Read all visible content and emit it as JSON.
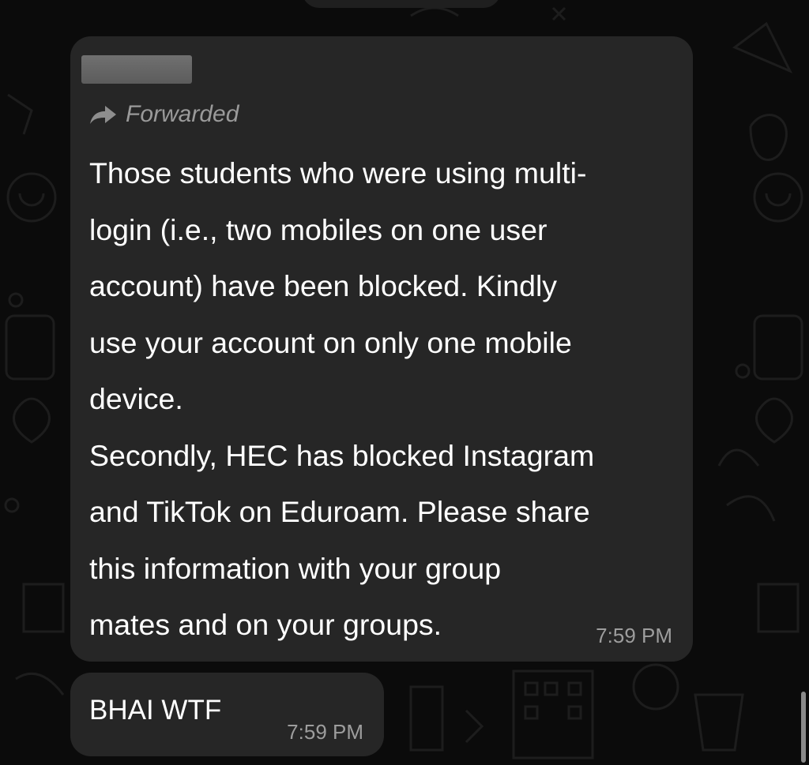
{
  "messages": [
    {
      "forwarded_label": "Forwarded",
      "text": "Those students who were using multi-\nlogin (i.e., two mobiles on one user\naccount) have been blocked. Kindly\nuse your account on only one mobile\ndevice.\nSecondly, HEC has blocked Instagram\nand TikTok on Eduroam. Please share\nthis information with your group\nmates and on your groups.",
      "time": "7:59 PM"
    },
    {
      "text": "BHAI WTF",
      "time": "7:59 PM"
    }
  ],
  "icons": {
    "forwarded": "forward-arrow-icon"
  },
  "colors": {
    "background": "#0b0b0b",
    "bubble": "#262626",
    "timestamp": "#9d9d9d",
    "forwarded": "#9a9a9a"
  }
}
